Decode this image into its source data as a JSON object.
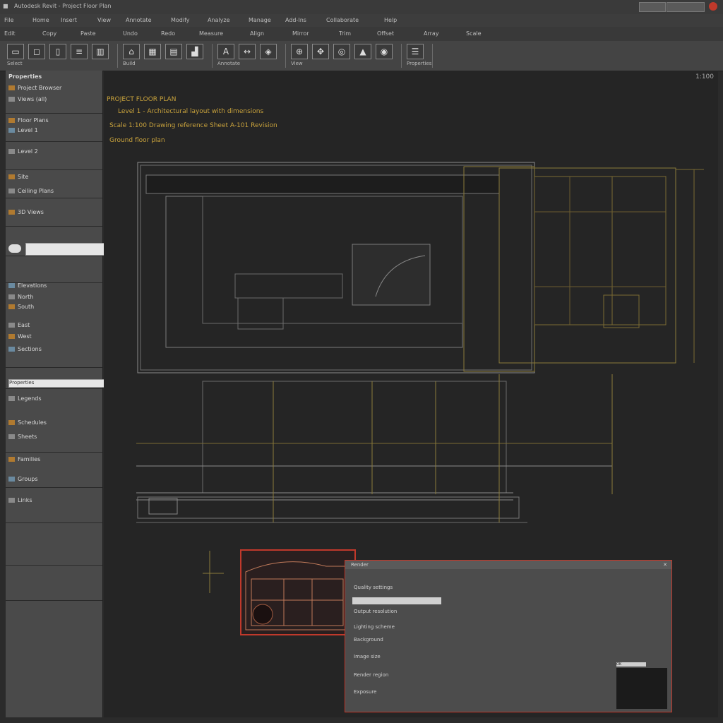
{
  "app": {
    "title": "Autodesk Revit - Project Floor Plan",
    "window_controls": [
      "minimize",
      "maximize",
      "close"
    ]
  },
  "menubar": {
    "items": [
      "File",
      "Home",
      "Insert",
      "View",
      "Annotate",
      "Modify",
      "Analyze",
      "Manage",
      "Add-Ins",
      "Collaborate",
      "Help"
    ]
  },
  "toolbar2": {
    "items": [
      "Edit",
      "Copy",
      "Paste",
      "Undo",
      "Redo",
      "Measure",
      "Align",
      "Mirror",
      "Trim",
      "Offset",
      "Array",
      "Scale"
    ]
  },
  "ribbon": {
    "groups": [
      {
        "label": "Select",
        "buttons": [
          "select-icon",
          "window-icon",
          "door-icon",
          "wall-icon",
          "column-icon"
        ]
      },
      {
        "label": "Build",
        "buttons": [
          "roof-icon",
          "floor-icon",
          "ceiling-icon",
          "stair-icon"
        ]
      },
      {
        "label": "Annotate",
        "buttons": [
          "text-icon",
          "dimension-icon",
          "tag-icon"
        ]
      },
      {
        "label": "View",
        "buttons": [
          "zoom-icon",
          "pan-icon",
          "orbit-icon",
          "section-icon",
          "render-icon"
        ]
      },
      {
        "label": "Properties",
        "buttons": [
          "properties-icon"
        ]
      }
    ]
  },
  "leftpanel": {
    "title": "Properties",
    "rows": [
      "Project Browser",
      "Views (all)",
      "Floor Plans",
      "Level 1",
      "Level 2",
      "Site",
      "Ceiling Plans",
      "3D Views",
      "Elevations",
      "North",
      "South",
      "East",
      "West",
      "Sections",
      "Legends",
      "Schedules",
      "Sheets",
      "Families",
      "Groups",
      "Links"
    ],
    "search_placeholder": "",
    "filter_value": "Properties"
  },
  "canvas": {
    "annotations": [
      "PROJECT FLOOR PLAN",
      "Level 1 - Architectural layout with dimensions",
      "Scale 1:100  Drawing reference  Sheet A-101  Revision",
      "Ground floor plan"
    ],
    "coords": "1:100"
  },
  "dialog": {
    "title": "Render",
    "lines": [
      "Quality settings",
      "Output resolution",
      "Lighting scheme",
      "Background",
      "Image size",
      "Render region",
      "Exposure"
    ],
    "button": "OK"
  },
  "colors": {
    "annotation": "#c8a23c",
    "linework_yellow": "#8a7a3a",
    "linework_white": "#9a9a9a",
    "selection_red": "#c0392b"
  }
}
